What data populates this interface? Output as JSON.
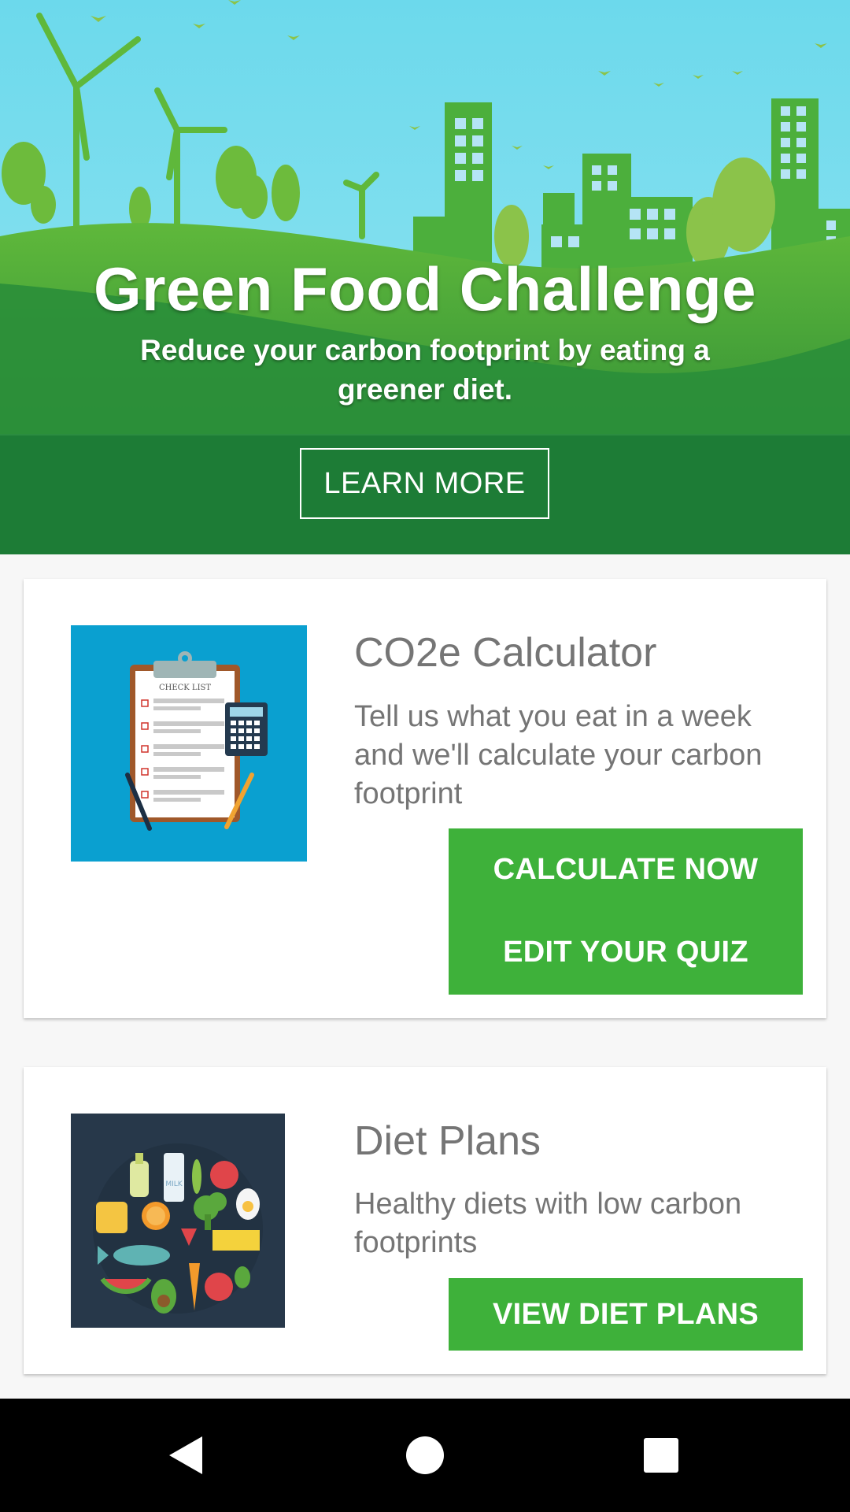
{
  "banner": {
    "title": "Green Food Challenge",
    "subtitle": "Reduce your carbon footprint by eating a greener diet.",
    "learn_more_label": "LEARN MORE",
    "colors": {
      "sky": "#6cd9ec",
      "hill": "#2a8e3a",
      "band": "#1d7c36"
    }
  },
  "cards": {
    "calculator": {
      "title": "CO2e Calculator",
      "description": "Tell us what you eat in a week and we'll calculate your carbon footprint",
      "image_label": "CHECK LIST",
      "buttons": {
        "calculate": "CALCULATE NOW",
        "edit_quiz": "EDIT YOUR QUIZ"
      },
      "image_icon": "clipboard-checklist-icon"
    },
    "diet_plans": {
      "title": "Diet Plans",
      "description": "Healthy diets with low carbon footprints",
      "button_label": "VIEW DIET PLANS",
      "image_icon": "food-assortment-icon",
      "image_label": "MILK"
    }
  },
  "theme": {
    "button_green": "#3eb13a",
    "text_gray": "#757575"
  },
  "navbar": {
    "back_icon": "back-icon",
    "home_icon": "home-icon",
    "recents_icon": "recents-icon"
  }
}
